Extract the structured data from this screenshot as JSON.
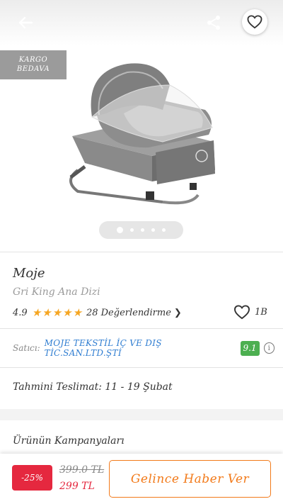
{
  "header": {
    "back_icon": "arrow-left-icon",
    "share_icon": "share-icon",
    "favorite_icon": "heart-outline-icon"
  },
  "gallery": {
    "badge_line1": "KARGO",
    "badge_line2": "BEDAVA",
    "image_alt": "product-photo-rocking-baby-bassinet",
    "total_images": 5,
    "active_index": 0
  },
  "product": {
    "brand": "Moje",
    "name": "Gri King Ana Dizi",
    "rating": "4.9",
    "stars": 5,
    "review_text": "28 Değerlendirme",
    "likes": "1B"
  },
  "seller": {
    "label": "Satıcı:",
    "name": "MOJE TEKSTİL İÇ VE DIŞ TİC.SAN.LTD.ŞTİ",
    "score": "9.1"
  },
  "delivery": {
    "text": "Tahmini Teslimat: 11 - 19 Şubat"
  },
  "campaigns": {
    "title": "Ürünün Kampanyaları"
  },
  "bottom_bar": {
    "discount": "-25%",
    "old_price": "399.0 TL",
    "new_price": "299 TL",
    "button_label": "Gelince Haber Ver"
  },
  "colors": {
    "accent": "#f27a1a",
    "discount_red": "#e5283f",
    "seller_blue": "#2f7dd1",
    "score_green": "#4caf50",
    "star": "#f5a623"
  }
}
